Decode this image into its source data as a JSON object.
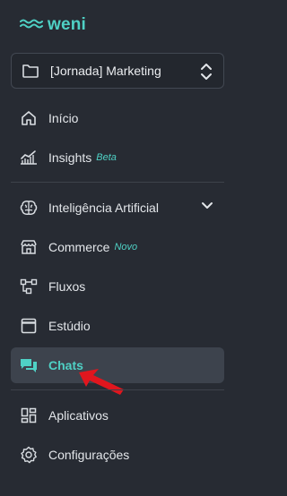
{
  "brand": {
    "name": "weni",
    "accent": "#4fd1c5"
  },
  "project": {
    "name": "[Jornada] Marketing",
    "icon": "folder-icon",
    "selector_icon": "chevron-up-down-icon"
  },
  "nav": {
    "inicio": {
      "label": "Início",
      "icon": "home-icon"
    },
    "insights": {
      "label": "Insights",
      "tag": "Beta",
      "icon": "chart-line-icon"
    },
    "ia": {
      "label": "Inteligência Artificial",
      "icon": "brain-icon",
      "expand_icon": "chevron-down-icon"
    },
    "commerce": {
      "label": "Commerce",
      "tag": "Novo",
      "icon": "store-icon"
    },
    "fluxos": {
      "label": "Fluxos",
      "icon": "flow-icon"
    },
    "estudio": {
      "label": "Estúdio",
      "icon": "window-icon"
    },
    "chats": {
      "label": "Chats",
      "icon": "chat-bubbles-icon",
      "active": true
    },
    "aplicativos": {
      "label": "Aplicativos",
      "icon": "apps-icon"
    },
    "configuracoes": {
      "label": "Configurações",
      "icon": "gear-icon"
    }
  },
  "colors": {
    "background": "#272b33",
    "active_background": "#3d434d",
    "annotation_arrow": "#e0161e"
  }
}
